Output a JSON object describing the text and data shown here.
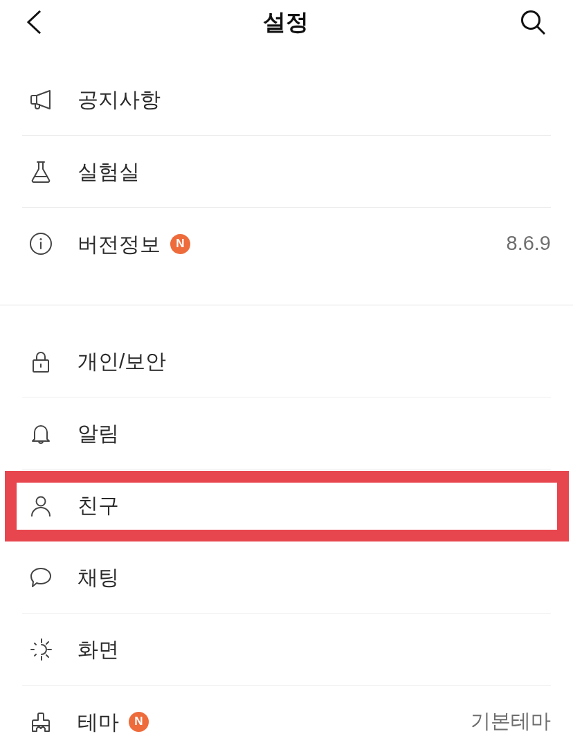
{
  "header": {
    "title": "설정"
  },
  "sections": [
    {
      "items": [
        {
          "label": "공지사항",
          "highlighted": false
        },
        {
          "label": "실험실",
          "highlighted": false
        },
        {
          "label": "버전정보",
          "badge": "N",
          "value": "8.6.9",
          "highlighted": false
        }
      ]
    },
    {
      "items": [
        {
          "label": "개인/보안",
          "highlighted": false
        },
        {
          "label": "알림",
          "highlighted": false
        },
        {
          "label": "친구",
          "highlighted": true
        },
        {
          "label": "채팅",
          "highlighted": false
        },
        {
          "label": "화면",
          "highlighted": false
        },
        {
          "label": "테마",
          "badge": "N",
          "value": "기본테마",
          "highlighted": false
        }
      ]
    }
  ]
}
